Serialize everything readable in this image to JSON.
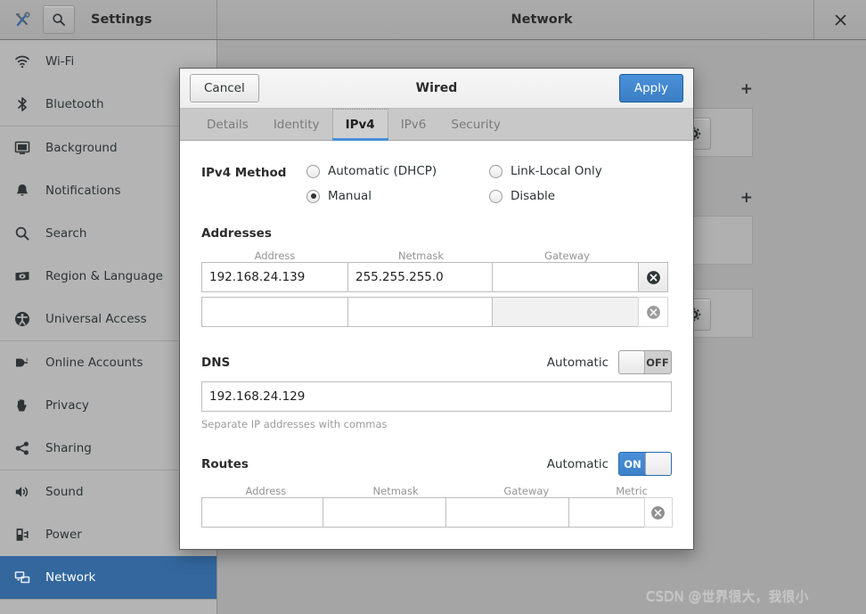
{
  "window": {
    "app_title": "Settings",
    "panel_title": "Network",
    "tools_icon": "tools-icon",
    "search_icon": "search-icon",
    "close_icon": "close-icon"
  },
  "sidebar": {
    "items": [
      {
        "label": "Wi-Fi",
        "icon": "wifi-icon",
        "selected": false
      },
      {
        "label": "Bluetooth",
        "icon": "bluetooth-icon",
        "selected": false
      },
      {
        "label": "Background",
        "icon": "background-icon",
        "selected": false
      },
      {
        "label": "Notifications",
        "icon": "bell-icon",
        "selected": false
      },
      {
        "label": "Search",
        "icon": "search-icon",
        "selected": false
      },
      {
        "label": "Region & Language",
        "icon": "region-language-icon",
        "selected": false
      },
      {
        "label": "Universal Access",
        "icon": "accessibility-icon",
        "selected": false
      },
      {
        "label": "Online Accounts",
        "icon": "online-accounts-icon",
        "selected": false
      },
      {
        "label": "Privacy",
        "icon": "hand-icon",
        "selected": false
      },
      {
        "label": "Sharing",
        "icon": "share-icon",
        "selected": false
      },
      {
        "label": "Sound",
        "icon": "speaker-icon",
        "selected": false
      },
      {
        "label": "Power",
        "icon": "power-plug-icon",
        "selected": false
      },
      {
        "label": "Network",
        "icon": "network-icon",
        "selected": true
      }
    ],
    "selected_color": "#33679e"
  },
  "background_panel": {
    "add_button_label": "+",
    "gear_icon": "gear-icon"
  },
  "dialog": {
    "title": "Wired",
    "cancel_label": "Cancel",
    "apply_label": "Apply",
    "apply_color": "#3b7fc4",
    "tabs": [
      {
        "label": "Details",
        "active": false
      },
      {
        "label": "Identity",
        "active": false
      },
      {
        "label": "IPv4",
        "active": true
      },
      {
        "label": "IPv6",
        "active": false
      },
      {
        "label": "Security",
        "active": false
      }
    ],
    "ipv4_method": {
      "label": "IPv4 Method",
      "options": [
        {
          "label": "Automatic (DHCP)",
          "checked": false
        },
        {
          "label": "Link-Local Only",
          "checked": false
        },
        {
          "label": "Manual",
          "checked": true
        },
        {
          "label": "Disable",
          "checked": false
        }
      ]
    },
    "addresses": {
      "section_label": "Addresses",
      "columns": [
        "Address",
        "Netmask",
        "Gateway"
      ],
      "rows": [
        {
          "address": "192.168.24.139",
          "netmask": "255.255.255.0",
          "gateway": "",
          "gateway_disabled": false,
          "delete_icon": "delete-circle-icon",
          "delete_enabled": true
        },
        {
          "address": "",
          "netmask": "",
          "gateway": "",
          "gateway_disabled": true,
          "delete_icon": "delete-circle-icon",
          "delete_enabled": false
        }
      ]
    },
    "dns": {
      "section_label": "DNS",
      "automatic_label": "Automatic",
      "toggle_state": "OFF",
      "value": "192.168.24.129",
      "hint": "Separate IP addresses with commas"
    },
    "routes": {
      "section_label": "Routes",
      "automatic_label": "Automatic",
      "toggle_state": "ON",
      "columns": [
        "Address",
        "Netmask",
        "Gateway",
        "Metric"
      ],
      "rows": [
        {
          "address": "",
          "netmask": "",
          "gateway": "",
          "metric": "",
          "delete_icon": "delete-circle-icon",
          "delete_enabled": false
        }
      ]
    }
  },
  "watermark": {
    "text": "CSDN @世界很大，我很小"
  }
}
